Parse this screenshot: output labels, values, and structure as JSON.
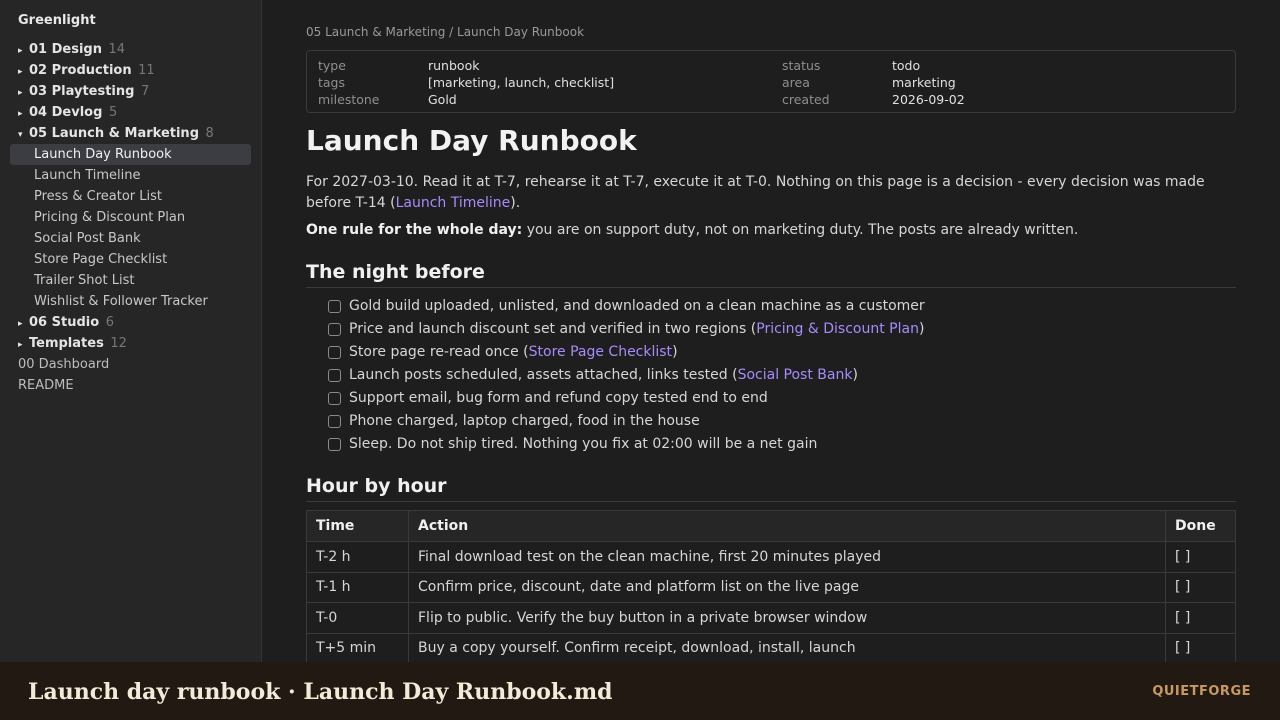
{
  "sidebar": {
    "vault_name": "Greenlight",
    "items": [
      {
        "kind": "folder",
        "arrow": "▸",
        "label": "01 Design",
        "count": "14"
      },
      {
        "kind": "folder",
        "arrow": "▸",
        "label": "02 Production",
        "count": "11"
      },
      {
        "kind": "folder",
        "arrow": "▸",
        "label": "03 Playtesting",
        "count": "7"
      },
      {
        "kind": "folder",
        "arrow": "▸",
        "label": "04 Devlog",
        "count": "5"
      },
      {
        "kind": "folder",
        "arrow": "▾",
        "label": "05 Launch & Marketing",
        "count": "8"
      },
      {
        "kind": "file",
        "label": "Launch Day Runbook",
        "active": true
      },
      {
        "kind": "file",
        "label": "Launch Timeline"
      },
      {
        "kind": "file",
        "label": "Press & Creator List"
      },
      {
        "kind": "file",
        "label": "Pricing & Discount Plan"
      },
      {
        "kind": "file",
        "label": "Social Post Bank"
      },
      {
        "kind": "file",
        "label": "Store Page Checklist"
      },
      {
        "kind": "file",
        "label": "Trailer Shot List"
      },
      {
        "kind": "file",
        "label": "Wishlist & Follower Tracker"
      },
      {
        "kind": "folder",
        "arrow": "▸",
        "label": "06 Studio",
        "count": "6"
      },
      {
        "kind": "folder",
        "arrow": "▸",
        "label": "Templates",
        "count": "12"
      },
      {
        "kind": "root",
        "label": "00 Dashboard"
      },
      {
        "kind": "root",
        "label": "README"
      }
    ]
  },
  "breadcrumb": "05 Launch & Marketing / Launch Day Runbook",
  "properties": {
    "type": {
      "key": "type",
      "value": "runbook"
    },
    "tags": {
      "key": "tags",
      "value": "[marketing, launch, checklist]"
    },
    "milestone": {
      "key": "milestone",
      "value": "Gold"
    },
    "status": {
      "key": "status",
      "value": "todo"
    },
    "area": {
      "key": "area",
      "value": "marketing"
    },
    "created": {
      "key": "created",
      "value": "2026-09-02"
    }
  },
  "doc": {
    "title": "Launch Day Runbook",
    "intro_before": "For 2027-03-10. Read it at T-7, rehearse it at T-7, execute it at T-0. Nothing on this page is a decision - every decision was made before T-14 (",
    "intro_link": "Launch Timeline",
    "intro_after": ").",
    "rule_bold": "One rule for the whole day:",
    "rule_text": " you are on support duty, not on marketing duty. The posts are already written.",
    "h_night": "The night before",
    "checklist": [
      {
        "text": "Gold build uploaded, unlisted, and downloaded on a clean machine as a customer",
        "link": "",
        "after": ""
      },
      {
        "text": "Price and launch discount set and verified in two regions (",
        "link": "Pricing & Discount Plan",
        "after": ")"
      },
      {
        "text": "Store page re-read once (",
        "link": "Store Page Checklist",
        "after": ")"
      },
      {
        "text": "Launch posts scheduled, assets attached, links tested (",
        "link": "Social Post Bank",
        "after": ")"
      },
      {
        "text": "Support email, bug form and refund copy tested end to end",
        "link": "",
        "after": ""
      },
      {
        "text": "Phone charged, laptop charged, food in the house",
        "link": "",
        "after": ""
      },
      {
        "text": "Sleep. Do not ship tired. Nothing you fix at 02:00 will be a net gain",
        "link": "",
        "after": ""
      }
    ],
    "h_hour": "Hour by hour",
    "table": {
      "headers": [
        "Time",
        "Action",
        "Done"
      ],
      "rows": [
        [
          "T-2 h",
          "Final download test on the clean machine, first 20 minutes played",
          "[ ]"
        ],
        [
          "T-1 h",
          "Confirm price, discount, date and platform list on the live page",
          "[ ]"
        ],
        [
          "T-0",
          "Flip to public. Verify the buy button in a private browser window",
          "[ ]"
        ],
        [
          "T+5 min",
          "Buy a copy yourself. Confirm receipt, download, install, launch",
          "[ ]"
        ]
      ]
    }
  },
  "footer": {
    "title": "Launch day runbook · Launch Day Runbook.md",
    "brand": "QUIETFORGE"
  },
  "colors": {
    "link": "#a78bfa",
    "footer_bg": "#221a12",
    "brand": "#c79a64"
  }
}
